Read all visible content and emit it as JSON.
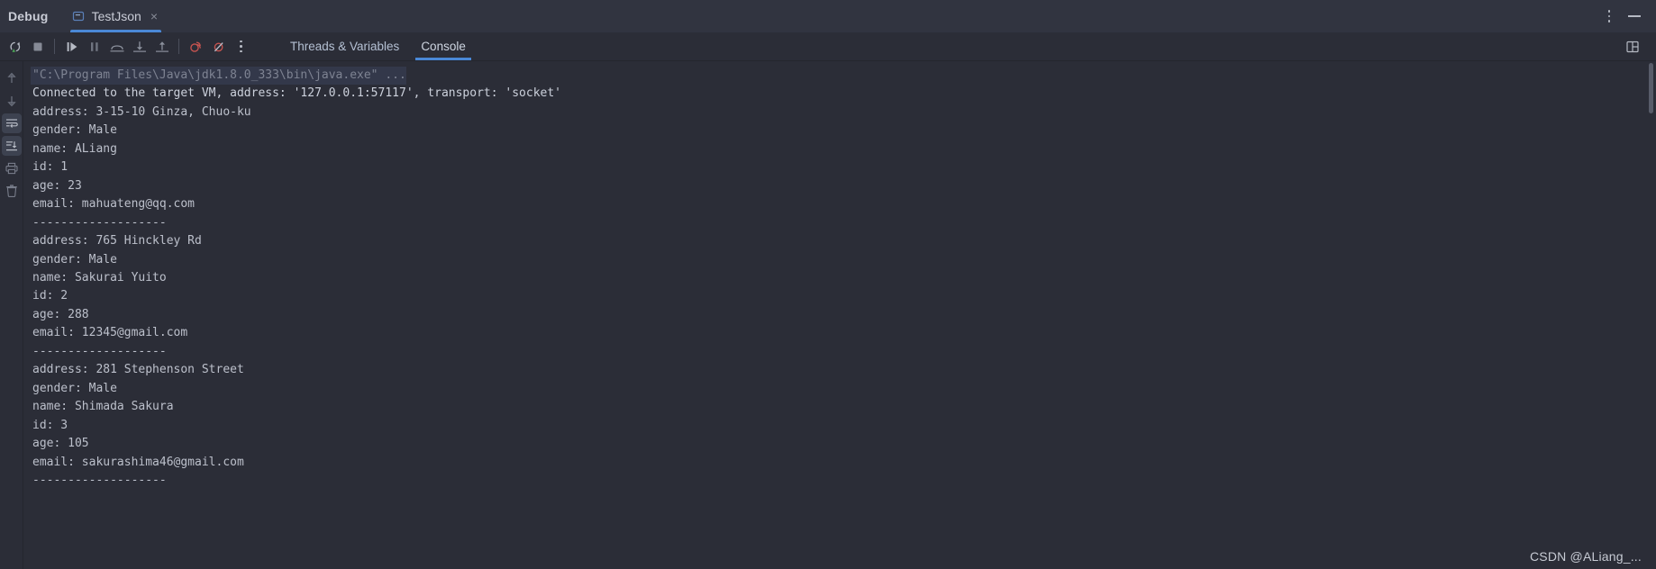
{
  "window": {
    "title": "Debug",
    "tab": {
      "label": "TestJson",
      "close": "×",
      "icon": "run-configuration-icon"
    },
    "kebab_icon": "more-options-icon",
    "minimize_icon": "minimize-icon"
  },
  "toolbar": {
    "buttons": [
      {
        "name": "rerun-button",
        "icon": "rerun-icon",
        "label": "Rerun"
      },
      {
        "name": "stop-button",
        "icon": "stop-icon",
        "label": "Stop"
      },
      {
        "name": "resume-button",
        "icon": "resume-program-icon",
        "label": "Resume Program"
      },
      {
        "name": "pause-button",
        "icon": "pause-program-icon",
        "label": "Pause Program"
      },
      {
        "name": "step-over-button",
        "icon": "step-over-icon",
        "label": "Step Over"
      },
      {
        "name": "step-into-button",
        "icon": "step-into-icon",
        "label": "Step Into"
      },
      {
        "name": "step-out-button",
        "icon": "step-out-icon",
        "label": "Step Out"
      },
      {
        "name": "view-breakpoints-button",
        "icon": "breakpoint-icon",
        "label": "View Breakpoints"
      },
      {
        "name": "mute-breakpoints-button",
        "icon": "mute-breakpoints-icon",
        "label": "Mute Breakpoints"
      },
      {
        "name": "more-options-button",
        "icon": "more-options-icon",
        "label": "More"
      }
    ],
    "layout_button": {
      "name": "layout-settings-button",
      "icon": "layout-icon"
    }
  },
  "view_tabs": [
    {
      "label": "Threads & Variables",
      "active": false
    },
    {
      "label": "Console",
      "active": true
    }
  ],
  "console_gutter": [
    {
      "name": "scroll-up-button",
      "icon": "arrow-up-icon",
      "selected": false
    },
    {
      "name": "scroll-down-button",
      "icon": "arrow-down-icon",
      "selected": false
    },
    {
      "name": "soft-wrap-button",
      "icon": "soft-wrap-icon",
      "selected": true
    },
    {
      "name": "scroll-to-end-button",
      "icon": "scroll-to-end-icon",
      "selected": true
    },
    {
      "name": "print-button",
      "icon": "print-icon",
      "selected": false
    },
    {
      "name": "clear-all-button",
      "icon": "trash-icon",
      "selected": false
    }
  ],
  "console": {
    "command_line": "\"C:\\Program Files\\Java\\jdk1.8.0_333\\bin\\java.exe\" ...",
    "connected_line": "Connected to the target VM, address: '127.0.0.1:57117', transport: 'socket'",
    "lines": [
      "address: 3-15-10 Ginza, Chuo-ku",
      "gender: Male",
      "name: ALiang",
      "id: 1",
      "age: 23",
      "email: mahuateng@qq.com",
      "-------------------",
      "address: 765 Hinckley Rd",
      "gender: Male",
      "name: Sakurai Yuito",
      "id: 2",
      "age: 288",
      "email: 12345@gmail.com",
      "-------------------",
      "address: 281 Stephenson Street",
      "gender: Male",
      "name: Shimada Sakura",
      "id: 3",
      "age: 105",
      "email: sakurashima46@gmail.com",
      "-------------------"
    ]
  },
  "watermark": "CSDN @ALiang_...",
  "colors": {
    "accent": "#4a88d6",
    "background": "#2b2d37",
    "toolbar_background": "#313440",
    "text": "#bcc0cb",
    "breakpoint_red": "#c75450"
  }
}
